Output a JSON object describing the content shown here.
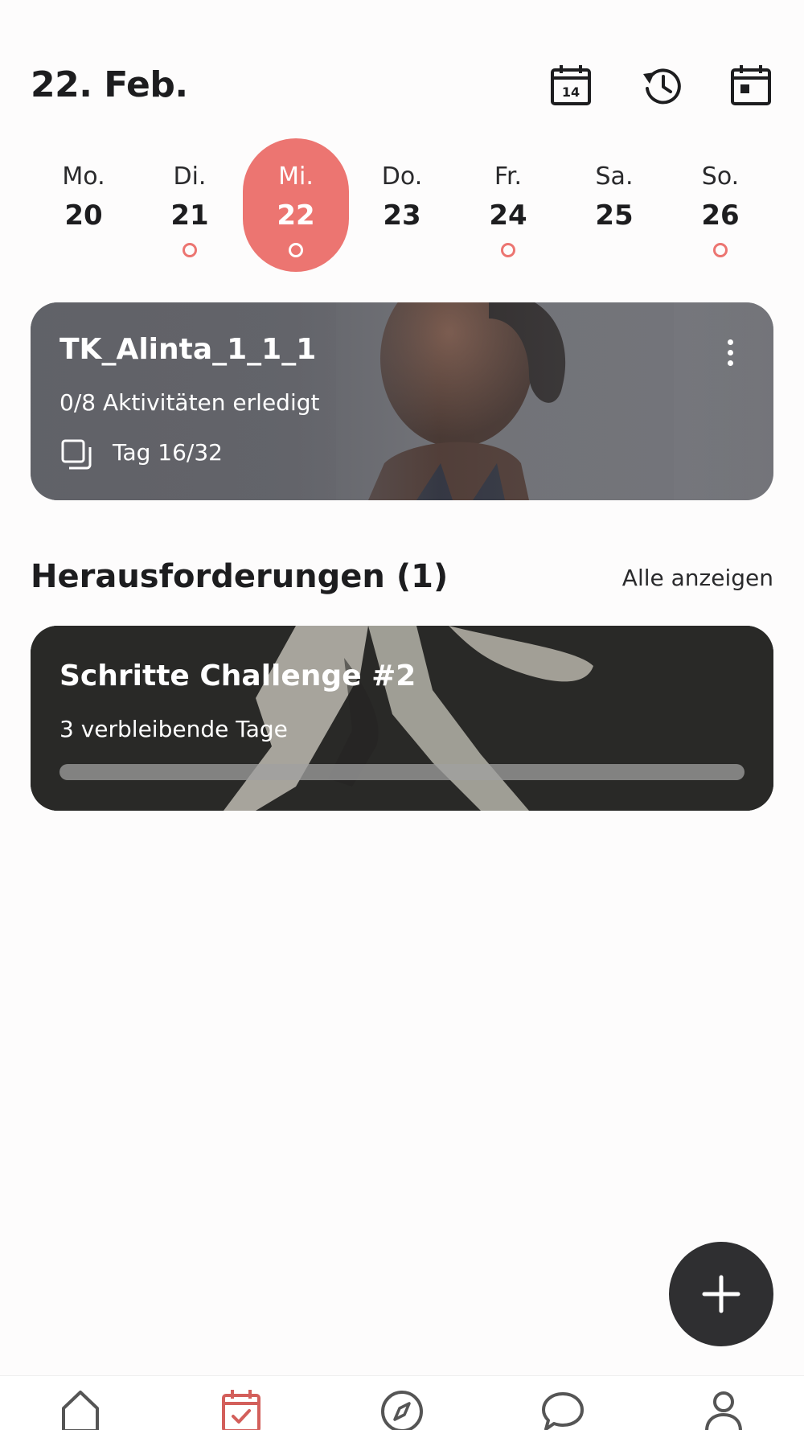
{
  "header": {
    "date": "22. Feb.",
    "icons": [
      "calendar-14-icon",
      "history-icon",
      "calendar-today-icon"
    ],
    "calendar_icon_number": "14"
  },
  "week": {
    "days": [
      {
        "name": "Mo.",
        "date": "20",
        "has_activity": false,
        "selected": false
      },
      {
        "name": "Di.",
        "date": "21",
        "has_activity": true,
        "selected": false
      },
      {
        "name": "Mi.",
        "date": "22",
        "has_activity": true,
        "selected": true
      },
      {
        "name": "Do.",
        "date": "23",
        "has_activity": false,
        "selected": false
      },
      {
        "name": "Fr.",
        "date": "24",
        "has_activity": true,
        "selected": false
      },
      {
        "name": "Sa.",
        "date": "25",
        "has_activity": false,
        "selected": false
      },
      {
        "name": "So.",
        "date": "26",
        "has_activity": true,
        "selected": false
      }
    ]
  },
  "plan": {
    "title": "TK_Alinta_1_1_1",
    "activities": "0/8 Aktivitäten erledigt",
    "day": "Tag 16/32"
  },
  "challenges": {
    "heading": "Herausforderungen (1)",
    "show_all": "Alle anzeigen",
    "items": [
      {
        "title": "Schritte Challenge #2",
        "remaining": "3 verbleibende Tage",
        "progress": 0.0
      }
    ]
  },
  "bottom_nav": {
    "items": [
      "home-icon",
      "plan-calendar-icon",
      "explore-compass-icon",
      "chat-icon",
      "profile-icon"
    ],
    "active": "plan-calendar-icon"
  },
  "colors": {
    "accent": "#ec7571",
    "text": "#1d1d1f",
    "fab": "#2f2f31"
  }
}
